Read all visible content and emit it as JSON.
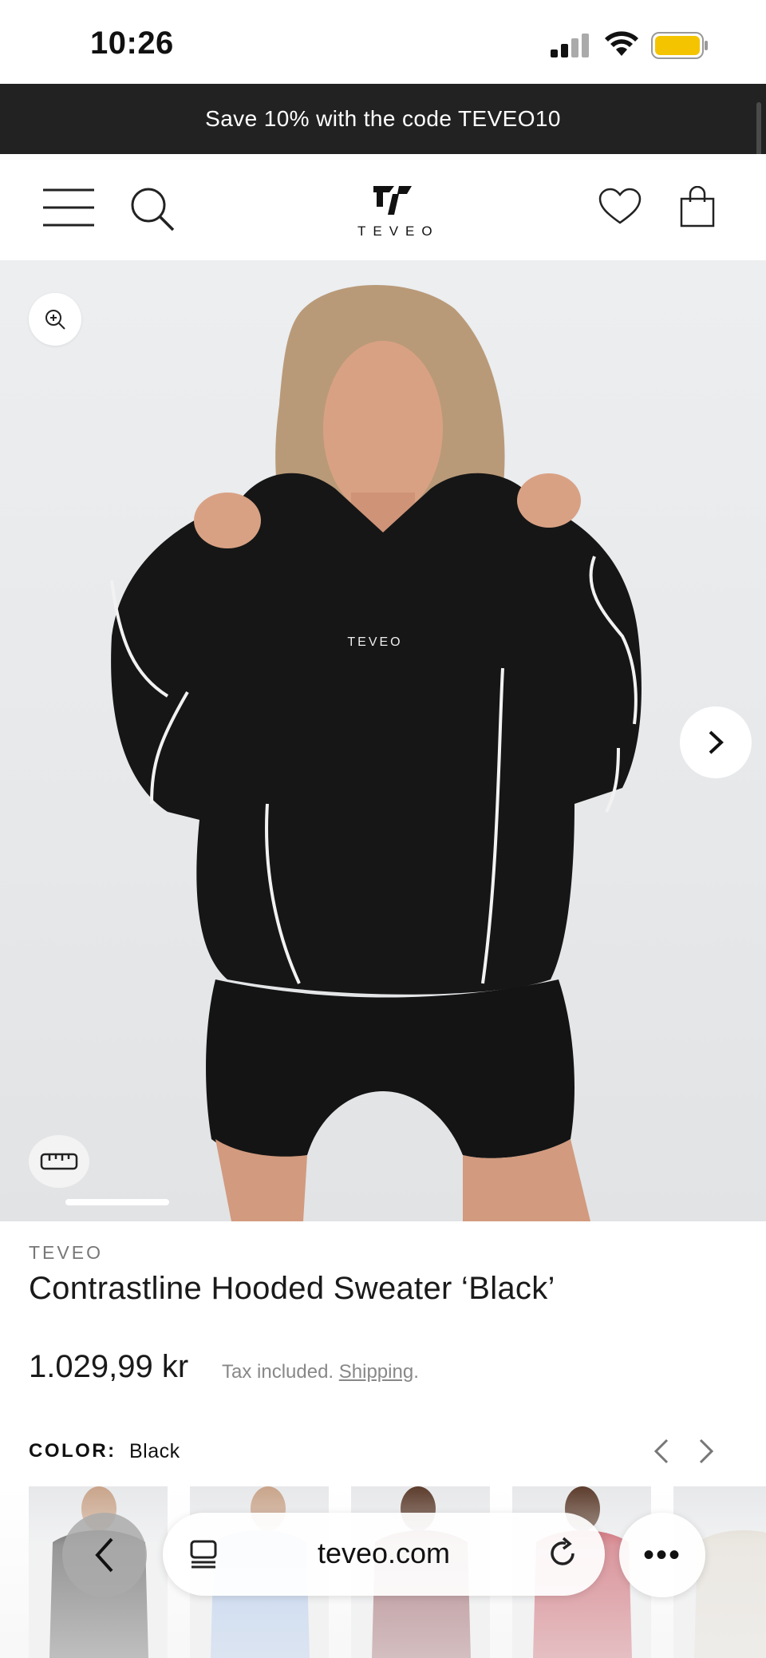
{
  "status_bar": {
    "time": "10:26"
  },
  "promo": {
    "text": "Save 10% with the code TEVEO10"
  },
  "header": {
    "logo_text": "TEVEO"
  },
  "hero": {
    "shirt_print": "TEVEO",
    "image_count_indicator": "1"
  },
  "product": {
    "brand": "TEVEO",
    "title": "Contrastline Hooded Sweater ‘Black’",
    "price": "1.029,99 kr",
    "tax_text": "Tax included.",
    "shipping_link": "Shipping",
    "tax_suffix": "."
  },
  "color": {
    "label": "COLOR:",
    "value": "Black",
    "swatches": [
      {
        "name": "Black",
        "color": "#1c1c1c"
      },
      {
        "name": "Blue",
        "color": "#8fb2e6"
      },
      {
        "name": "Burgundy",
        "color": "#6e1a22"
      },
      {
        "name": "Red",
        "color": "#b41e2c"
      },
      {
        "name": "Beige",
        "color": "#d9d2c6"
      }
    ]
  },
  "browser": {
    "url": "teveo.com",
    "more_label": "•••"
  },
  "colors": {
    "banner_bg": "#222222",
    "battery": "#f5c400"
  }
}
